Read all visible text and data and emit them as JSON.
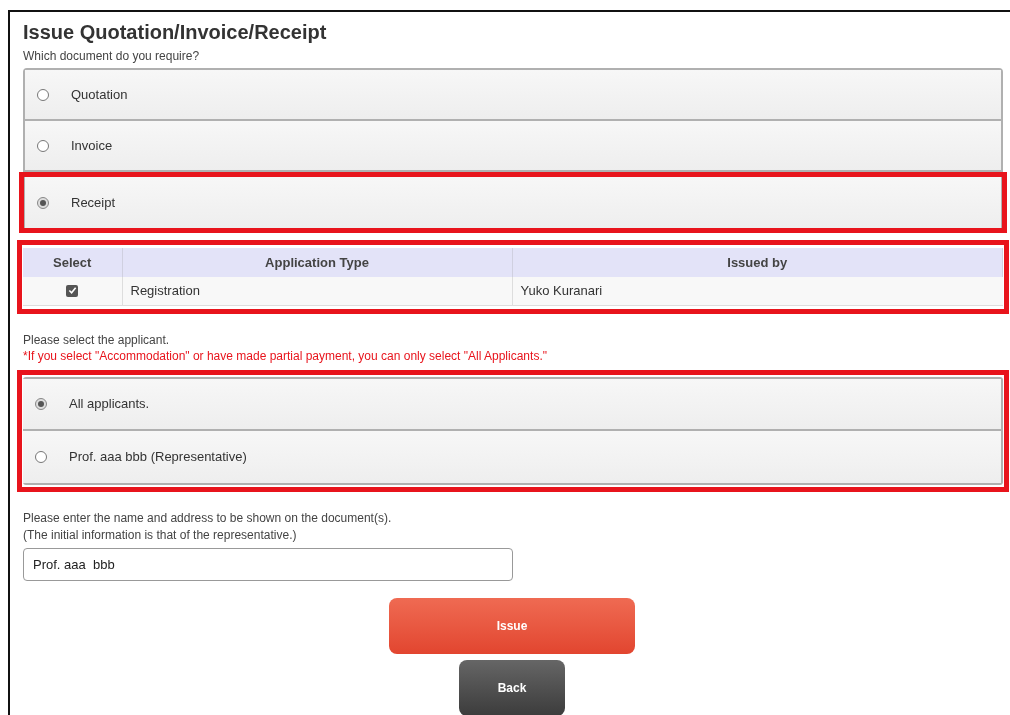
{
  "title": "Issue Quotation/Invoice/Receipt",
  "document_prompt": "Which document do you require?",
  "document_options": [
    {
      "label": "Quotation",
      "selected": false,
      "highlighted": false
    },
    {
      "label": "Invoice",
      "selected": false,
      "highlighted": false
    },
    {
      "label": "Receipt",
      "selected": true,
      "highlighted": true
    }
  ],
  "table": {
    "highlighted": true,
    "columns": [
      "Select",
      "Application Type",
      "Issued by"
    ],
    "rows": [
      {
        "checked": true,
        "application_type": "Registration",
        "issued_by": "Yuko Kuranari"
      }
    ]
  },
  "applicant_prompt": "Please select the applicant.",
  "applicant_note": "*If you select \"Accommodation\" or have made partial payment, you can only select \"All Applicants.\"",
  "applicants": {
    "highlighted": true,
    "options": [
      {
        "label": "All applicants.",
        "selected": true
      },
      {
        "label": "Prof. aaa bbb (Representative)",
        "selected": false
      }
    ]
  },
  "name_prompt": [
    "Please enter the name and address to be shown on the document(s).",
    "(The initial information is that of the representative.)"
  ],
  "name_field": {
    "value": "Prof. aaa  bbb"
  },
  "buttons": [
    {
      "kind": "primary",
      "label": "Issue"
    },
    {
      "kind": "secondary",
      "label": "Back"
    }
  ]
}
